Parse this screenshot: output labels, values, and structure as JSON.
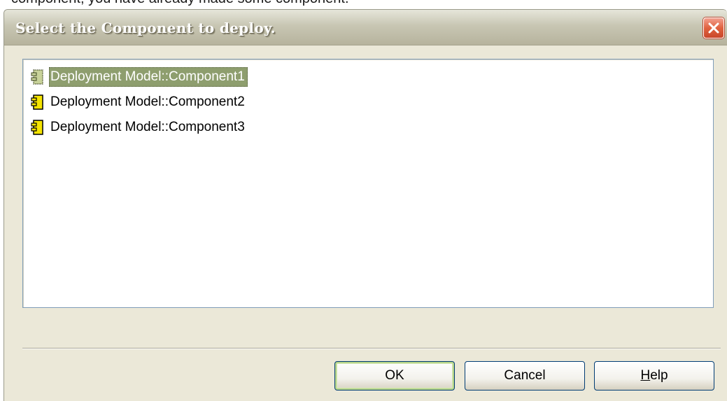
{
  "caption": "component, you have already made some component.",
  "dialog": {
    "title": "Select the Component to deploy.",
    "close_icon": "close-icon",
    "items": [
      {
        "label": "Deployment Model::Component1",
        "icon": "component-icon",
        "selected": true
      },
      {
        "label": "Deployment Model::Component2",
        "icon": "component-icon",
        "selected": false
      },
      {
        "label": "Deployment Model::Component3",
        "icon": "component-icon",
        "selected": false
      }
    ],
    "buttons": {
      "ok": "OK",
      "cancel": "Cancel",
      "help_mnemonic": "H",
      "help_rest": "elp"
    }
  },
  "colors": {
    "selection": "#8e9e6e",
    "close_button": "#e0623f",
    "component_icon": "#f5e400"
  }
}
